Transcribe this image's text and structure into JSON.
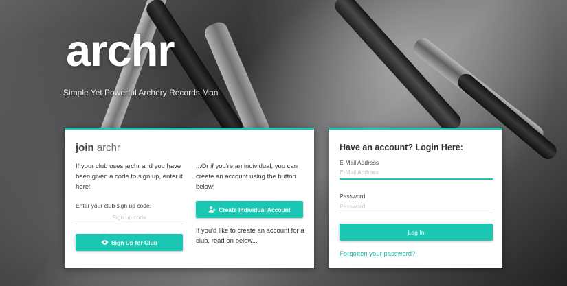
{
  "brand": {
    "name": "archr",
    "tagline": "Simple Yet Powerful Archery Records Man"
  },
  "join": {
    "title_bold": "join",
    "title_rest": "archr",
    "club_text": "If your club uses archr and you have been given a code to sign up, enter it here:",
    "code_label": "Enter your club sign up code:",
    "code_placeholder": "Sign up code",
    "signup_button": "Sign Up for Club",
    "individual_text": "...Or if you're an individual, you can create an account using the button below!",
    "individual_button": "Create Individual Account",
    "club_note": "If you'd like to create an account for a club, read on below..."
  },
  "login": {
    "title": "Have an account? Login Here:",
    "email_label": "E-Mail Address",
    "email_placeholder": "E-Mail Address",
    "password_label": "Password",
    "password_placeholder": "Password",
    "button": "Log In",
    "forgot_link": "Forgotten your password?"
  },
  "colors": {
    "accent": "#1cc8b4",
    "link": "#18b8a8"
  },
  "icons": {
    "signup_icon": "eye-icon",
    "individual_icon": "add-user-icon"
  }
}
